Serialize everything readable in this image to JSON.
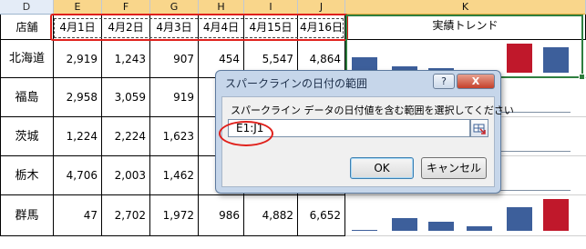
{
  "columns": [
    "D",
    "E",
    "F",
    "G",
    "H",
    "I",
    "J",
    "K"
  ],
  "header": {
    "store_label": "店舗",
    "dates": [
      "4月1日",
      "4月2日",
      "4月3日",
      "4月4日",
      "4月15日",
      "4月16日"
    ],
    "trend_label": "実績トレンド"
  },
  "rows": [
    {
      "store": "北海道",
      "values": [
        "2,919",
        "1,243",
        "907",
        "454",
        "5,547",
        "4,864"
      ]
    },
    {
      "store": "福島",
      "values": [
        "2,958",
        "3,059",
        "919",
        "",
        "",
        ""
      ]
    },
    {
      "store": "茨城",
      "values": [
        "1,224",
        "2,224",
        "1,623",
        "",
        "",
        ""
      ]
    },
    {
      "store": "栃木",
      "values": [
        "4,706",
        "2,003",
        "1,462",
        "",
        "",
        ""
      ]
    },
    {
      "store": "群馬",
      "values": [
        "47",
        "2,702",
        "1,972",
        "986",
        "4,882",
        "6,652"
      ]
    }
  ],
  "chart_data": {
    "type": "bar",
    "title": "",
    "sparkline_colors": {
      "normal": "#3d5f9b",
      "high": "#c0182b"
    },
    "series": [
      {
        "name": "北海道",
        "values": [
          2919,
          1243,
          907,
          454,
          5547,
          4864
        ],
        "highlight_index": 4
      },
      {
        "name": "福島",
        "values": [
          2958,
          3059,
          919,
          null,
          null,
          null
        ]
      },
      {
        "name": "茨城",
        "values": [
          1224,
          2224,
          1623,
          null,
          null,
          null
        ]
      },
      {
        "name": "栃木",
        "values": [
          4706,
          2003,
          1462,
          null,
          null,
          null
        ]
      },
      {
        "name": "群馬",
        "values": [
          47,
          2702,
          1972,
          986,
          4882,
          6652
        ],
        "highlight_index": 5
      }
    ]
  },
  "dialog": {
    "title": "スパークラインの日付の範囲",
    "help_label": "?",
    "close_label": "X",
    "prompt": "スパークライン データの日付値を含む範囲を選択してください",
    "input_value": "E1:J1",
    "ok_label": "OK",
    "cancel_label": "キャンセル"
  }
}
